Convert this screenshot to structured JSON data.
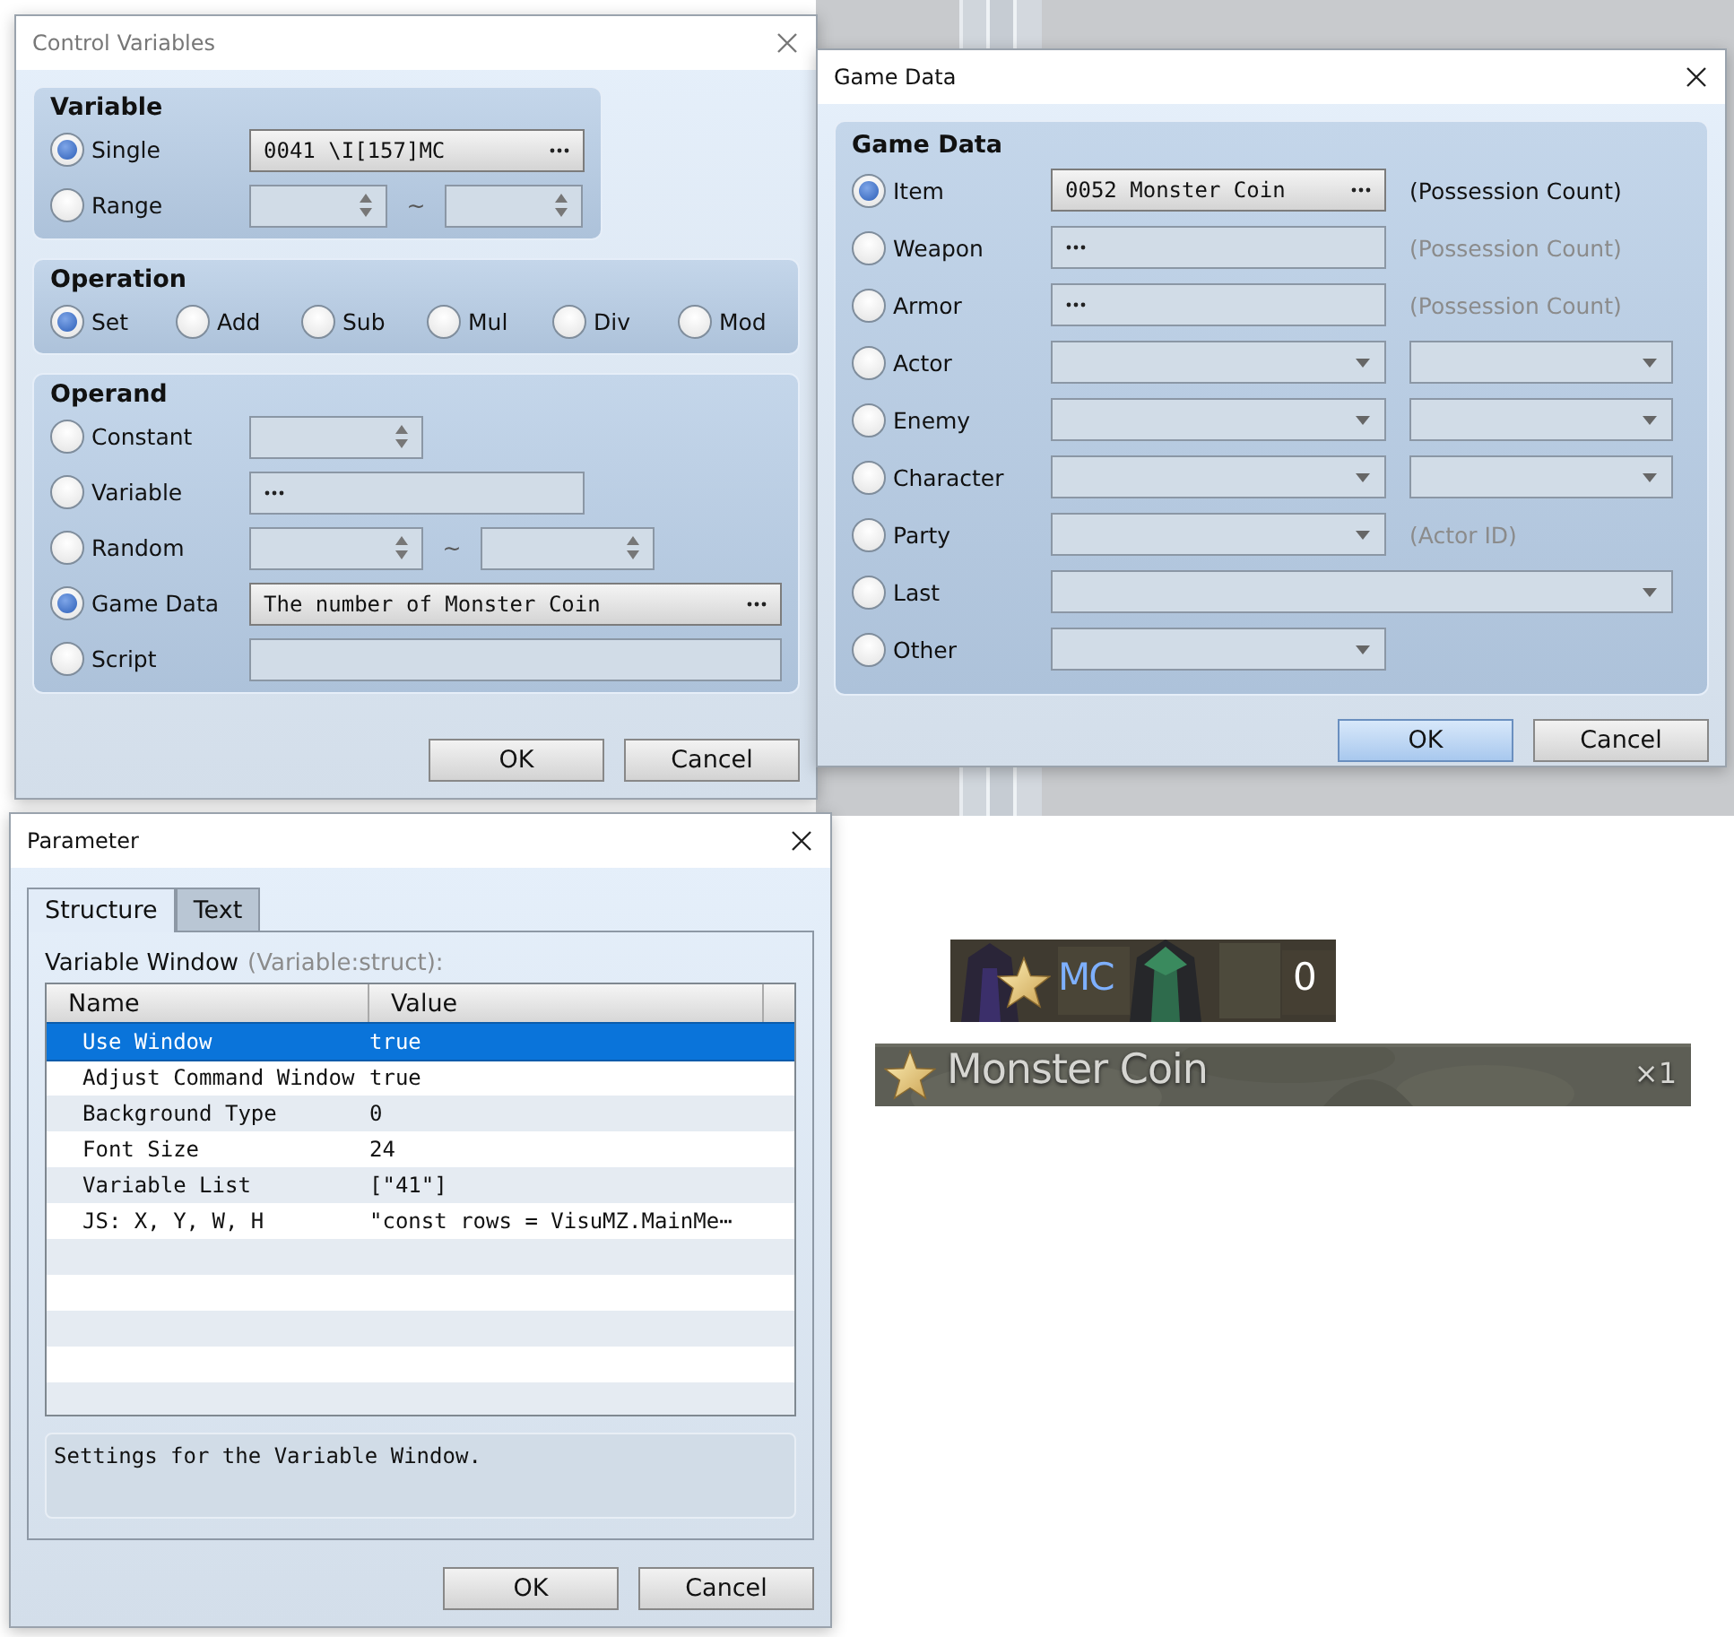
{
  "control_variables": {
    "title": "Control Variables",
    "active": false,
    "variable": {
      "heading": "Variable",
      "options": [
        {
          "label": "Single",
          "selected": true,
          "kind": "picker",
          "value": "0041 \\I[157]MC"
        },
        {
          "label": "Range",
          "selected": false,
          "kind": "spin_range",
          "separator": "~"
        }
      ]
    },
    "operation": {
      "heading": "Operation",
      "options": [
        {
          "label": "Set",
          "selected": true
        },
        {
          "label": "Add",
          "selected": false
        },
        {
          "label": "Sub",
          "selected": false
        },
        {
          "label": "Mul",
          "selected": false
        },
        {
          "label": "Div",
          "selected": false
        },
        {
          "label": "Mod",
          "selected": false
        }
      ]
    },
    "operand": {
      "heading": "Operand",
      "options": [
        {
          "label": "Constant",
          "selected": false,
          "kind": "spin"
        },
        {
          "label": "Variable",
          "selected": false,
          "kind": "picker"
        },
        {
          "label": "Random",
          "selected": false,
          "kind": "spin_range",
          "separator": "~"
        },
        {
          "label": "Game Data",
          "selected": true,
          "kind": "picker_wide",
          "value": "The number of Monster Coin"
        },
        {
          "label": "Script",
          "selected": false,
          "kind": "text_wide"
        }
      ]
    },
    "buttons": [
      {
        "label": "OK",
        "default": false
      },
      {
        "label": "Cancel",
        "default": false
      }
    ]
  },
  "game_data": {
    "title": "Game Data",
    "active": true,
    "heading": "Game Data",
    "options": [
      {
        "label": "Item",
        "selected": true,
        "kind": "picker",
        "value": "0052 Monster Coin",
        "note": {
          "text": "(Possession Count)",
          "disabled": false
        }
      },
      {
        "label": "Weapon",
        "selected": false,
        "kind": "picker",
        "note": {
          "text": "(Possession Count)",
          "disabled": true
        }
      },
      {
        "label": "Armor",
        "selected": false,
        "kind": "picker",
        "note": {
          "text": "(Possession Count)",
          "disabled": true
        }
      },
      {
        "label": "Actor",
        "selected": false,
        "kind": "dropdown_pair"
      },
      {
        "label": "Enemy",
        "selected": false,
        "kind": "dropdown_pair"
      },
      {
        "label": "Character",
        "selected": false,
        "kind": "dropdown_pair"
      },
      {
        "label": "Party",
        "selected": false,
        "kind": "dropdown",
        "note": {
          "text": "(Actor ID)",
          "disabled": true
        }
      },
      {
        "label": "Last",
        "selected": false,
        "kind": "dropdown_wide"
      },
      {
        "label": "Other",
        "selected": false,
        "kind": "dropdown"
      }
    ],
    "buttons": [
      {
        "label": "OK",
        "default": true
      },
      {
        "label": "Cancel",
        "default": false
      }
    ]
  },
  "parameter": {
    "title": "Parameter",
    "active": true,
    "tabs": [
      {
        "label": "Structure",
        "selected": true
      },
      {
        "label": "Text",
        "selected": false
      }
    ],
    "heading": "Variable Window",
    "type_hint": "(Variable:struct):",
    "columns": [
      "Name",
      "Value"
    ],
    "rows": [
      {
        "name": "Use Window",
        "value": "true",
        "selected": true
      },
      {
        "name": "Adjust Command Window",
        "value": "true",
        "selected": false
      },
      {
        "name": "Background Type",
        "value": "0",
        "selected": false
      },
      {
        "name": "Font Size",
        "value": "24",
        "selected": false
      },
      {
        "name": "Variable List",
        "value": "[\"41\"]",
        "selected": false
      },
      {
        "name": "JS: X, Y, W, H",
        "value": "\"const rows = VisuMZ.MainMe⋯",
        "selected": false
      }
    ],
    "description": "Settings for the Variable Window.",
    "buttons": [
      {
        "label": "OK",
        "default": false
      },
      {
        "label": "Cancel",
        "default": false
      }
    ]
  },
  "hud_window": {
    "label": "MC",
    "value": "0"
  },
  "item_bar": {
    "name": "Monster Coin",
    "count": "×1"
  }
}
